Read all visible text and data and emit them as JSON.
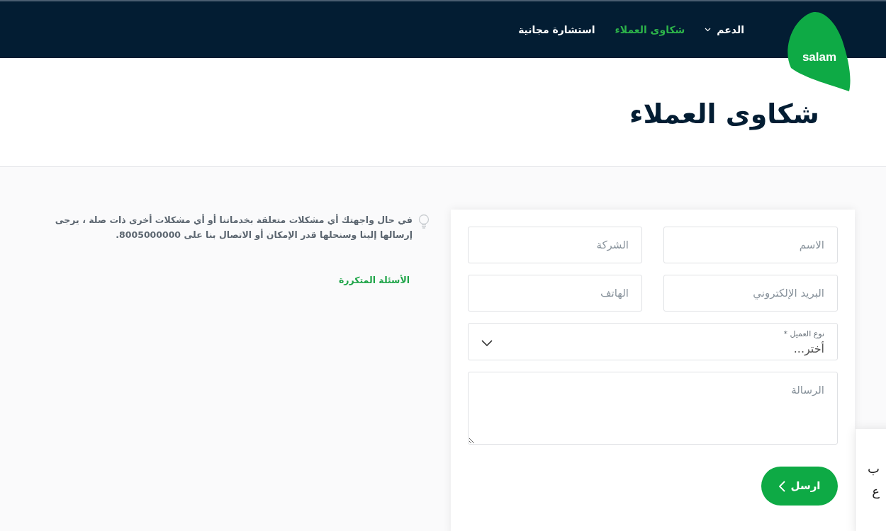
{
  "logo": {
    "text": "salam"
  },
  "nav": [
    {
      "label": "الدعم",
      "dropdown": true,
      "selected": false
    },
    {
      "label": "شكاوى العملاء",
      "dropdown": false,
      "selected": true
    },
    {
      "label": "استشارة مجانية",
      "dropdown": false,
      "selected": false
    }
  ],
  "page_title": "شكاوى العملاء",
  "info": {
    "text": "في حال واجهتك أي مشكلات متعلقة بخدماتنا أو أي مشكلات أخرى ذات صلة ، يرجى إرسالها إلينا وسنحلها قدر الإمكان أو الاتصال بنا على 8005000000.",
    "faq_link": "الأسئلة المتكررة"
  },
  "form": {
    "fields": [
      {
        "placeholder": "الاسم"
      },
      {
        "placeholder": "الشركة"
      },
      {
        "placeholder": "البريد الإلكتروني"
      },
      {
        "placeholder": "الهاتف"
      }
    ],
    "select": {
      "label": "نوع العميل *",
      "value": "أختر..."
    },
    "message": {
      "placeholder": "الرسالة"
    },
    "submit": "ارسل"
  },
  "side_popup": {
    "lines": [
      "ب",
      "ع"
    ]
  }
}
